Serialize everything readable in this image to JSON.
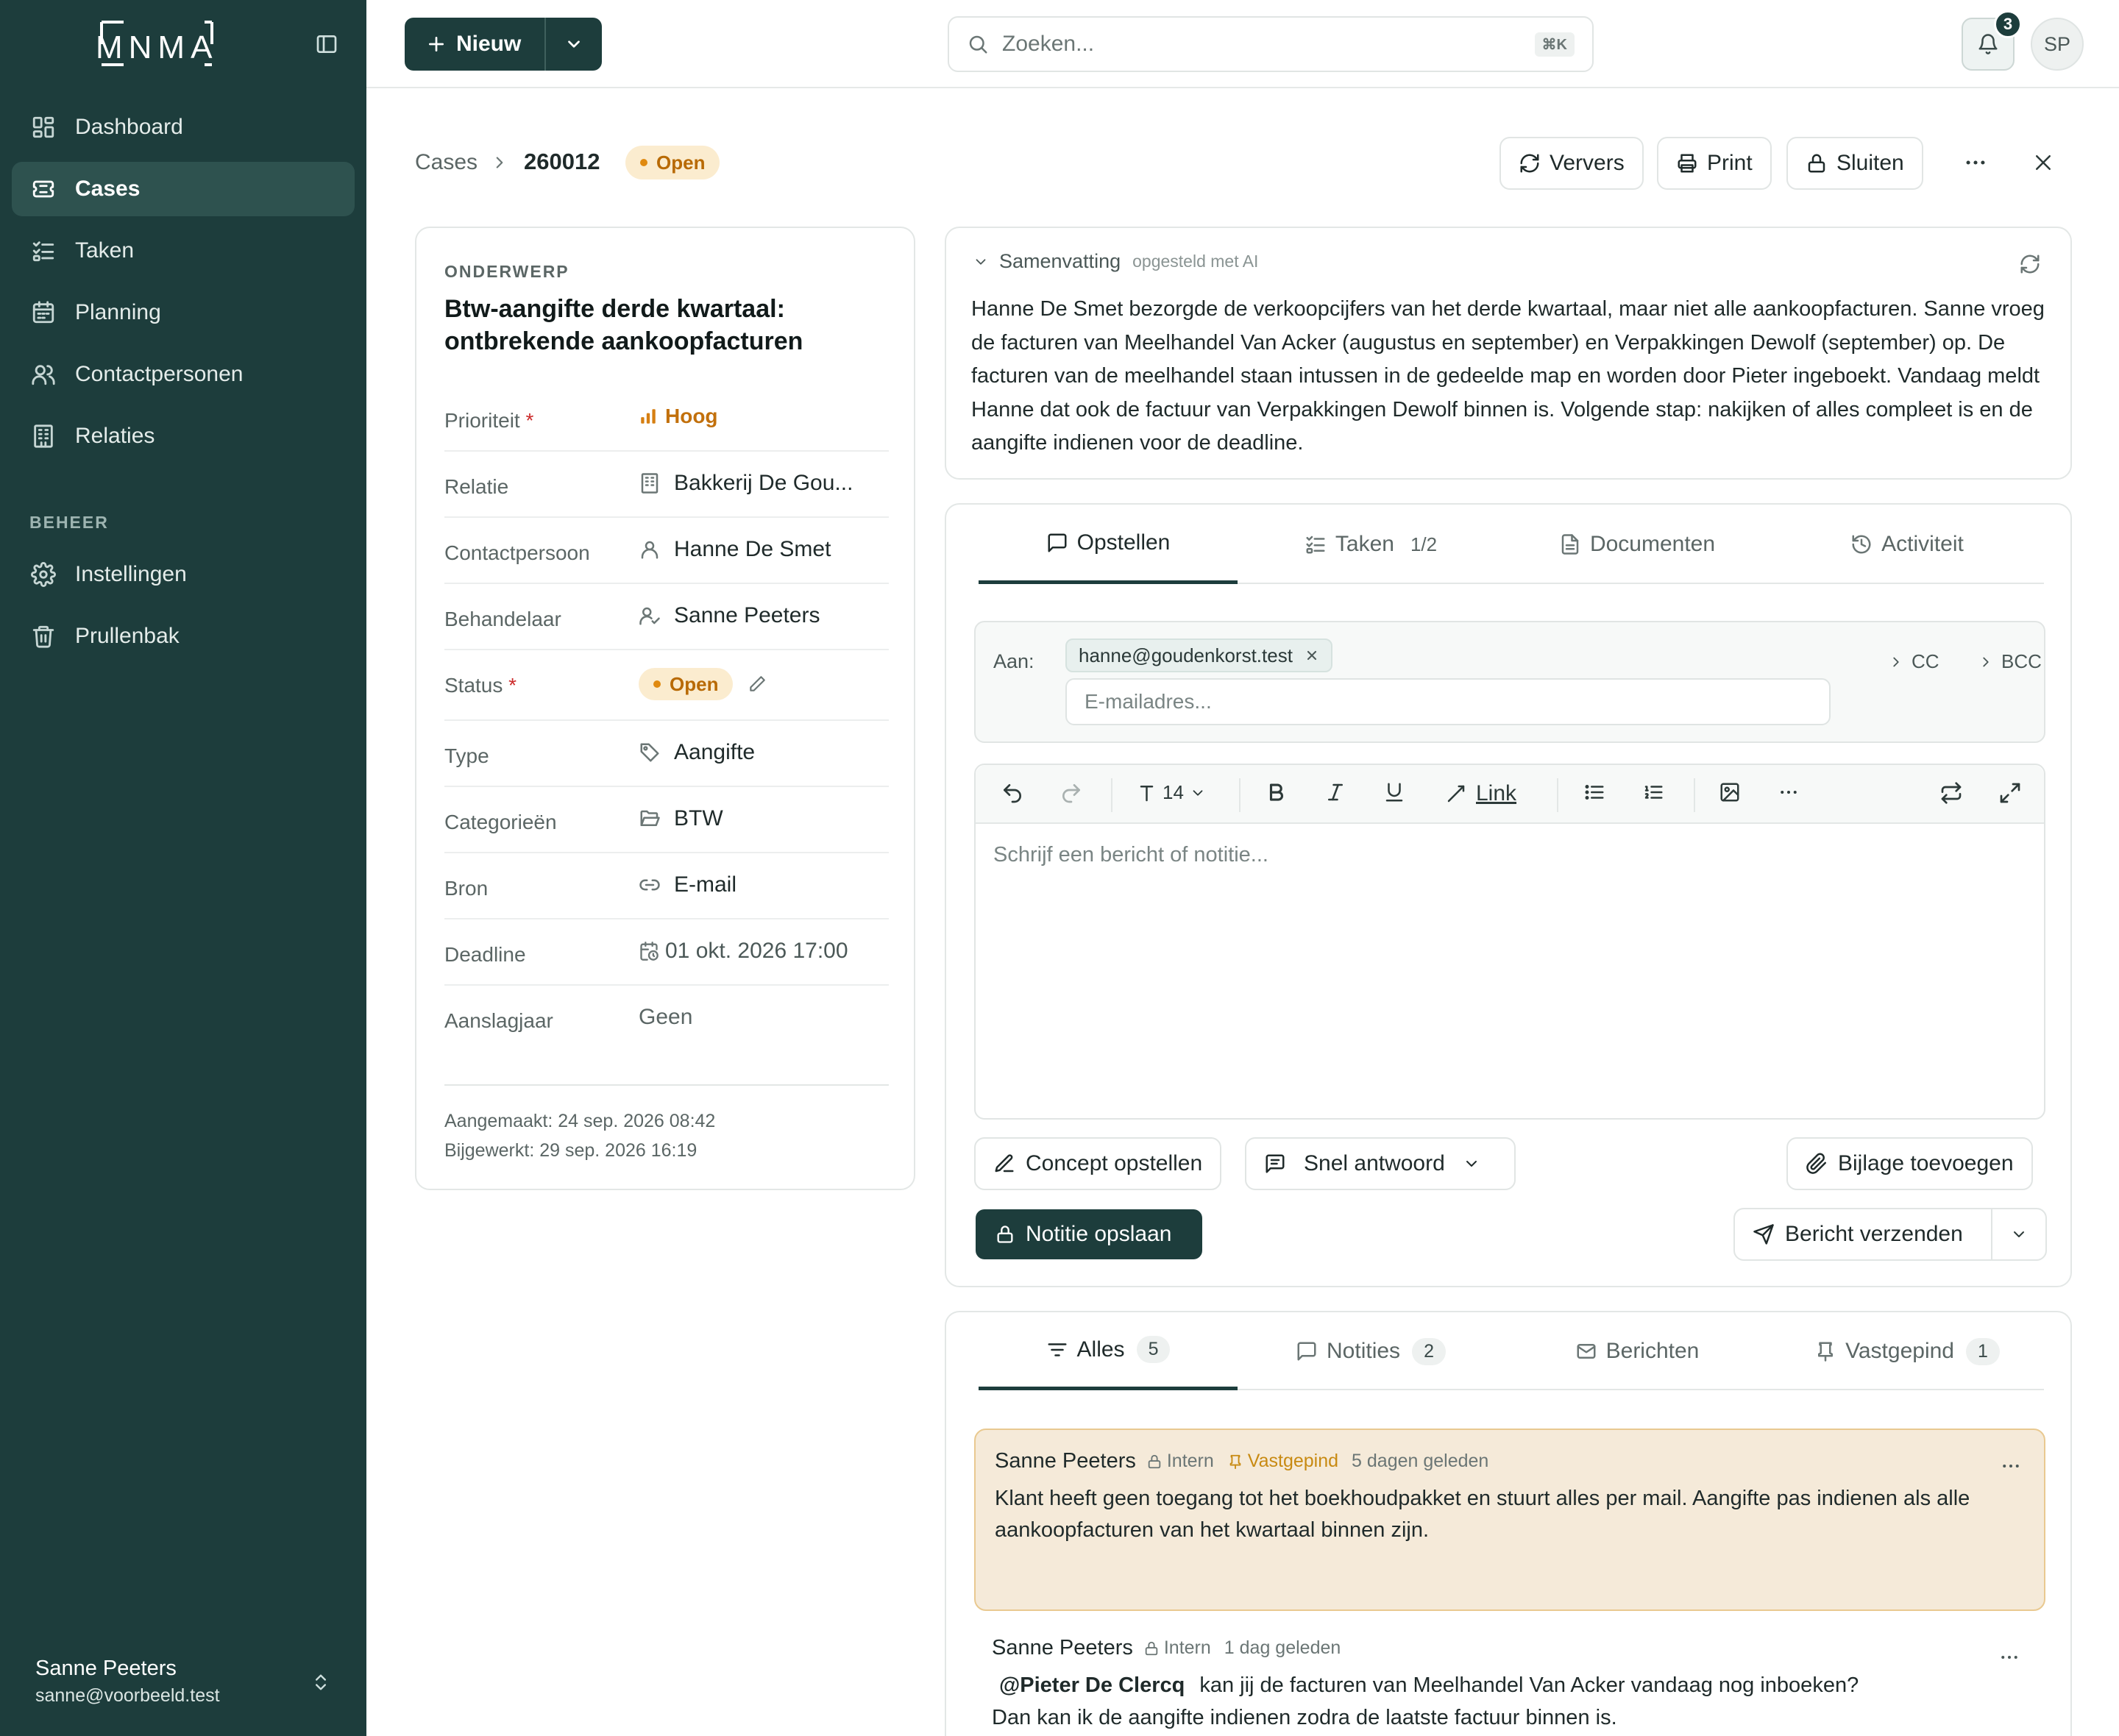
{
  "sidebar": {
    "logo": "MNMA",
    "items": [
      {
        "label": "Dashboard",
        "icon": "dashboard-icon"
      },
      {
        "label": "Cases",
        "icon": "ticket-icon",
        "active": true
      },
      {
        "label": "Taken",
        "icon": "tasks-icon"
      },
      {
        "label": "Planning",
        "icon": "calendar-icon"
      },
      {
        "label": "Contactpersonen",
        "icon": "users-icon"
      },
      {
        "label": "Relaties",
        "icon": "building-icon"
      }
    ],
    "section": "BEHEER",
    "admin_items": [
      {
        "label": "Instellingen",
        "icon": "gear-icon"
      },
      {
        "label": "Prullenbak",
        "icon": "trash-icon"
      }
    ],
    "user": {
      "name": "Sanne Peeters",
      "email": "sanne@voorbeeld.test"
    }
  },
  "topbar": {
    "new_label": "Nieuw",
    "search_placeholder": "Zoeken...",
    "search_shortcut": "⌘K",
    "notifications": "3",
    "avatar_initials": "SP"
  },
  "breadcrumb": {
    "root": "Cases",
    "case_id": "260012",
    "status": "Open"
  },
  "actions": {
    "refresh": "Ververs",
    "print": "Print",
    "close": "Sluiten"
  },
  "case": {
    "subject_label": "ONDERWERP",
    "subject": "Btw-aangifte derde kwartaal: ontbrekende aankoopfacturen",
    "properties": [
      {
        "label": "Prioriteit",
        "required": "*",
        "value": "Hoog"
      },
      {
        "label": "Relatie",
        "value": "Bakkerij De Gou..."
      },
      {
        "label": "Contactpersoon",
        "value": "Hanne De Smet"
      },
      {
        "label": "Behandelaar",
        "value": "Sanne Peeters"
      },
      {
        "label": "Status",
        "required": "*",
        "value": "Open"
      },
      {
        "label": "Type",
        "value": "Aangifte"
      },
      {
        "label": "Categorieën",
        "value": "BTW"
      },
      {
        "label": "Bron",
        "value": "E-mail"
      },
      {
        "label": "Deadline",
        "value": "01 okt. 2026 17:00"
      },
      {
        "label": "Aanslagjaar",
        "value": "Geen"
      }
    ],
    "created": "Aangemaakt: 24 sep. 2026 08:42",
    "updated": "Bijgewerkt: 29 sep. 2026 16:19"
  },
  "summary": {
    "title": "Samenvatting",
    "ai_note": "opgesteld met AI",
    "text": "Hanne De Smet bezorgde de verkoopcijfers van het derde kwartaal, maar niet alle aankoopfacturen. Sanne vroeg de facturen van Meelhandel Van Acker (augustus en september) en Verpakkingen Dewolf (september) op. De facturen van de meelhandel staan intussen in de gedeelde map en worden door Pieter ingeboekt. Vandaag meldt Hanne dat ook de factuur van Verpakkingen Dewolf binnen is. Volgende stap: nakijken of alles compleet is en de aangifte indienen voor de deadline."
  },
  "compose": {
    "tabs": [
      {
        "label": "Opstellen"
      },
      {
        "label": "Taken",
        "count": "1/2"
      },
      {
        "label": "Documenten"
      },
      {
        "label": "Activiteit"
      }
    ],
    "to_label": "Aan:",
    "recipient": "hanne@goudenkorst.test",
    "email_placeholder": "E-mailadres...",
    "cc": "CC",
    "bcc": "BCC",
    "font_size": "14",
    "link_label": "Link",
    "editor_placeholder": "Schrijf een bericht of notitie...",
    "draft_label": "Concept opstellen",
    "quick_reply_label": "Snel antwoord",
    "attach_label": "Bijlage toevoegen",
    "save_note_label": "Notitie opslaan",
    "send_label": "Bericht verzenden"
  },
  "timeline": {
    "tabs": [
      {
        "label": "Alles",
        "count": "5"
      },
      {
        "label": "Notities",
        "count": "2"
      },
      {
        "label": "Berichten"
      },
      {
        "label": "Vastgepind",
        "count": "1"
      }
    ],
    "entries": [
      {
        "author": "Sanne Peeters",
        "visibility": "Intern",
        "pinned": "Vastgepind",
        "time": "5 dagen geleden",
        "text": "Klant heeft geen toegang tot het boekhoudpakket en stuurt alles per mail. Aangifte pas indienen als alle aankoopfacturen van het kwartaal binnen zijn."
      },
      {
        "author": "Sanne Peeters",
        "visibility": "Intern",
        "time": "1 dag geleden",
        "mention": "@Pieter De Clercq",
        "text": "kan jij de facturen van Meelhandel Van Acker vandaag nog inboeken?",
        "text2": "Dan kan ik de aangifte indienen zodra de laatste factuur binnen is."
      }
    ]
  },
  "colors": {
    "primary": "#1d3d3c",
    "accent_orange": "#c2700c",
    "pinned_bg": "#f5ead9"
  }
}
